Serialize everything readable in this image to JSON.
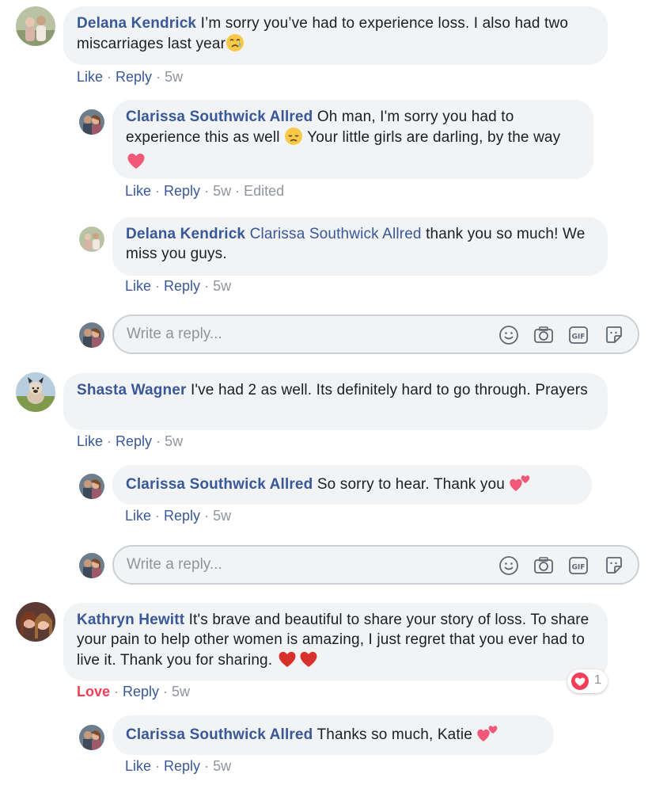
{
  "comments": [
    {
      "author": "Delana Kendrick",
      "text": "I’m sorry you’ve had to experience loss. I also had two miscarriages last year",
      "actions": {
        "like": "Like",
        "reply": "Reply",
        "time": "5w"
      },
      "replies": [
        {
          "author": "Clarissa Southwick Allred",
          "text_part1": "Oh man, I'm sorry you had to experience this as well",
          "text_part2": "Your little girls are darling, by the way",
          "actions": {
            "like": "Like",
            "reply": "Reply",
            "time": "5w",
            "edited": "Edited"
          }
        },
        {
          "author": "Delana Kendrick",
          "mention": "Clarissa Southwick Allred",
          "text": "thank you so much! We miss you guys.",
          "actions": {
            "like": "Like",
            "reply": "Reply",
            "time": "5w"
          }
        }
      ]
    },
    {
      "author": "Shasta Wagner",
      "text": "I've had 2 as well. Its definitely hard to go through. Prayers",
      "actions": {
        "like": "Like",
        "reply": "Reply",
        "time": "5w"
      },
      "replies": [
        {
          "author": "Clarissa Southwick Allred",
          "text": "So sorry to hear. Thank you",
          "actions": {
            "like": "Like",
            "reply": "Reply",
            "time": "5w"
          }
        }
      ]
    },
    {
      "author": "Kathryn Hewitt",
      "text": "It's brave and beautiful to share your story of loss. To share your pain to help other women is amazing, I just regret that you ever had to live it. Thank you for sharing.",
      "reaction_count": "1",
      "actions": {
        "love": "Love",
        "reply": "Reply",
        "time": "5w"
      },
      "replies": [
        {
          "author": "Clarissa Southwick Allred",
          "text": "Thanks so much, Katie",
          "actions": {
            "like": "Like",
            "reply": "Reply",
            "time": "5w"
          }
        }
      ]
    }
  ],
  "reply_box": {
    "placeholder": "Write a reply...",
    "icons": [
      "emoji-icon",
      "camera-icon",
      "gif-icon",
      "sticker-icon"
    ]
  },
  "colors": {
    "name_link": "#385898",
    "bubble_bg": "#f2f3f5",
    "meta_gray": "#90949c",
    "love_red": "#f33e58"
  }
}
